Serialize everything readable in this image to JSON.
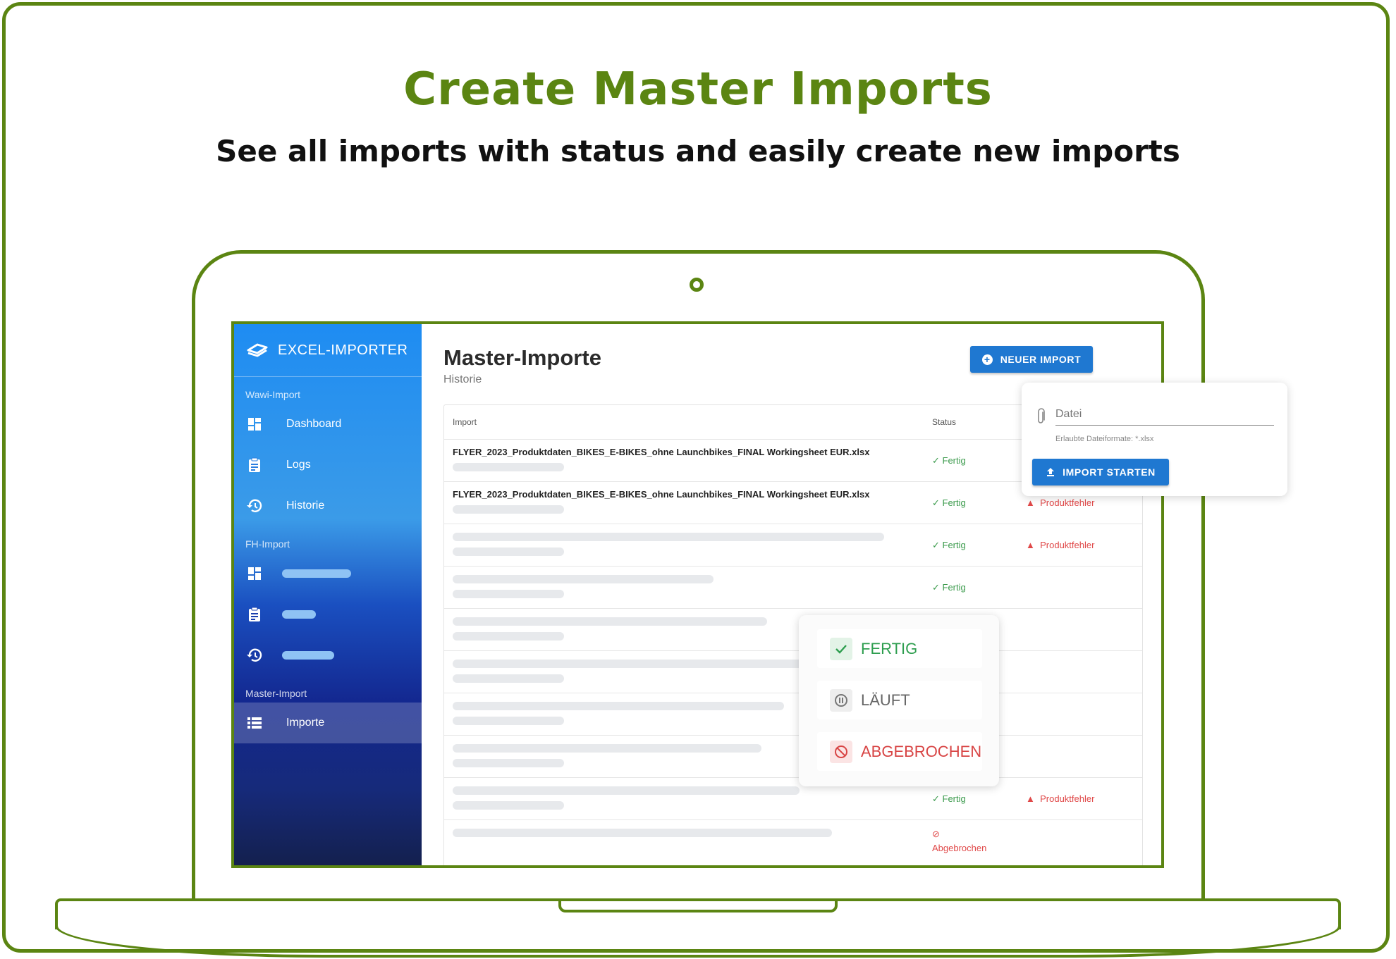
{
  "hero": {
    "title": "Create Master Imports",
    "subtitle": "See all imports with status and easily create new imports"
  },
  "sidebar": {
    "brand": "EXCEL-IMPORTER",
    "sections": [
      {
        "label": "Wawi-Import",
        "items": [
          {
            "label": "Dashboard",
            "icon": "dashboard-icon"
          },
          {
            "label": "Logs",
            "icon": "clipboard-icon"
          },
          {
            "label": "Historie",
            "icon": "history-icon"
          }
        ]
      },
      {
        "label": "FH-Import",
        "items": [
          {
            "icon": "dashboard-icon"
          },
          {
            "icon": "clipboard-icon"
          },
          {
            "icon": "history-icon"
          }
        ]
      },
      {
        "label": "Master-Import",
        "items": [
          {
            "label": "Importe",
            "icon": "list-icon",
            "active": true
          }
        ]
      }
    ]
  },
  "main": {
    "title": "Master-Importe",
    "subtitle": "Historie",
    "new_import_button": "NEUER IMPORT",
    "table": {
      "columns": [
        "Import",
        "Status"
      ],
      "rows": [
        {
          "file": "FLYER_2023_Produktdaten_BIKES_E-BIKES_ohne Launchbikes_FINAL Workingsheet EUR.xlsx",
          "status": "Fertig",
          "error": ""
        },
        {
          "file": "FLYER_2023_Produktdaten_BIKES_E-BIKES_ohne Launchbikes_FINAL Workingsheet EUR.xlsx",
          "status": "Fertig",
          "error": "Produktfehler"
        },
        {
          "file": "",
          "status": "Fertig",
          "error": "Produktfehler"
        },
        {
          "file": "",
          "status": "Fertig",
          "error": ""
        },
        {
          "file": "",
          "status": "",
          "error": ""
        },
        {
          "file": "",
          "status": "",
          "error": ""
        },
        {
          "file": "",
          "status": "",
          "error": ""
        },
        {
          "file": "",
          "status": "",
          "error": ""
        },
        {
          "file": "",
          "status": "Fertig",
          "error": "Produktfehler"
        },
        {
          "file": "",
          "status": "Abgebrochen",
          "error": ""
        }
      ]
    }
  },
  "upload": {
    "placeholder": "Datei",
    "hint": "Erlaubte Dateiformate: *.xlsx",
    "start_button": "IMPORT STARTEN"
  },
  "status_legend": [
    {
      "label": "FERTIG",
      "color": "#2e9e4f"
    },
    {
      "label": "LÄUFT",
      "color": "#666666"
    },
    {
      "label": "ABGEBROCHEN",
      "color": "#d84545"
    }
  ],
  "colors": {
    "brand_green": "#5b8512",
    "primary_blue": "#1f78d1",
    "ok_green": "#3a9a4b",
    "error_red": "#e04848"
  }
}
